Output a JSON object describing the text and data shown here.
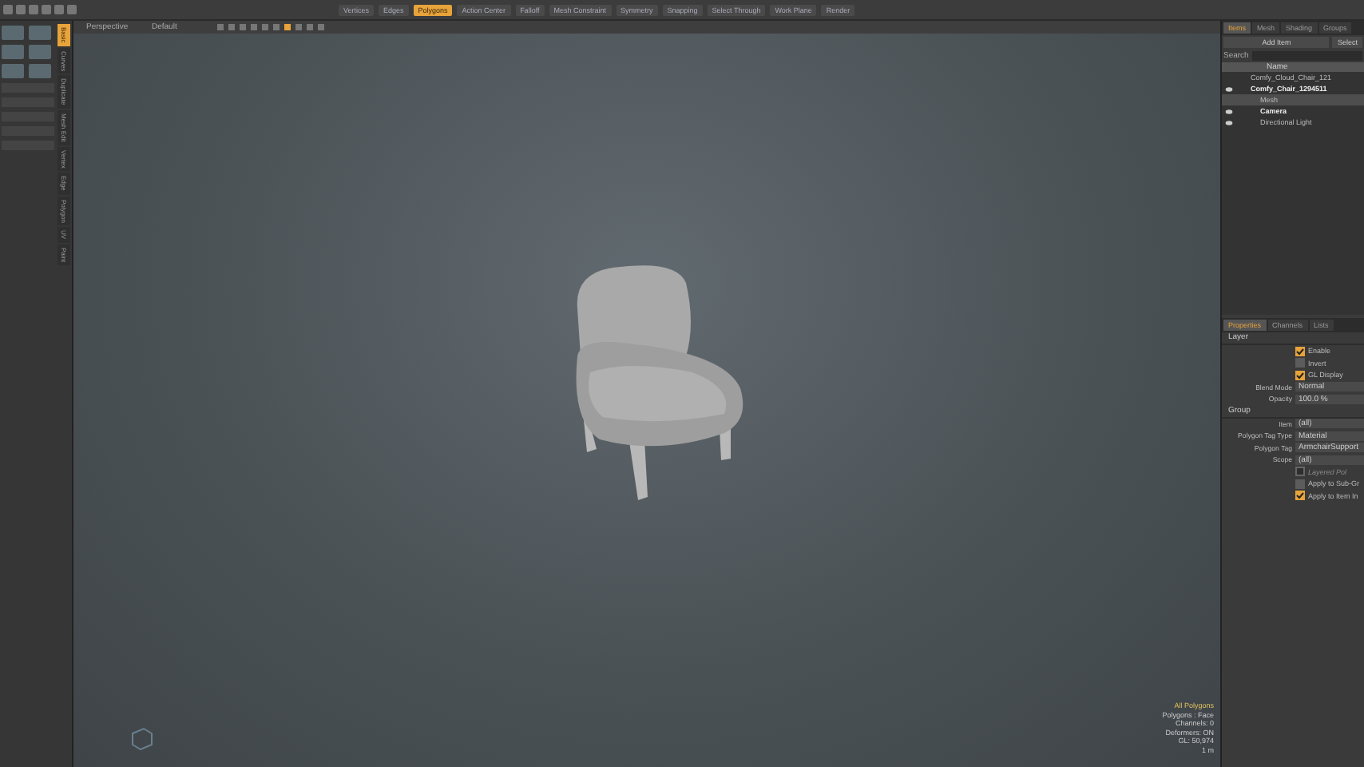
{
  "toolbar": {
    "items": [
      {
        "label": "Vertices",
        "selected": false
      },
      {
        "label": "Edges",
        "selected": false
      },
      {
        "label": "Polygons",
        "selected": true
      },
      {
        "label": "Action Center",
        "selected": false
      },
      {
        "label": "Falloff",
        "selected": false
      },
      {
        "label": "Mesh Constraint",
        "selected": false
      },
      {
        "label": "Symmetry",
        "selected": false
      },
      {
        "label": "Snapping",
        "selected": false
      },
      {
        "label": "Select Through",
        "selected": false
      },
      {
        "label": "Work Plane",
        "selected": false
      },
      {
        "label": "Render",
        "selected": false
      }
    ]
  },
  "left_panel": {
    "vertical_tabs": [
      {
        "label": "Basic",
        "selected": true
      },
      {
        "label": "Curves",
        "selected": false
      },
      {
        "label": "Duplicate",
        "selected": false
      },
      {
        "label": "Mesh Edit",
        "selected": false
      },
      {
        "label": "Vertex",
        "selected": false
      },
      {
        "label": "Edge",
        "selected": false
      },
      {
        "label": "Polygon",
        "selected": false
      },
      {
        "label": "UV",
        "selected": false
      },
      {
        "label": "Paint",
        "selected": false
      }
    ]
  },
  "viewport": {
    "view": "Perspective",
    "shading": "Default",
    "stats": [
      "All Polygons",
      "Polygons : Face",
      "Channels: 0",
      "Deformers: ON",
      "GL: 50,974",
      "1 m"
    ]
  },
  "items_panel": {
    "tabs": [
      {
        "label": "Items",
        "selected": true
      },
      {
        "label": "Mesh",
        "selected": false
      },
      {
        "label": "Shading",
        "selected": false
      },
      {
        "label": "Groups",
        "selected": false
      }
    ],
    "add_item": "Add Item",
    "select": "Select",
    "search_label": "Search",
    "name_header": "Name",
    "tree": [
      {
        "label": "Comfy_Cloud_Chair_121",
        "visible": false,
        "selected": false,
        "bold": false
      },
      {
        "label": "Comfy_Chair_1294511",
        "visible": true,
        "selected": false,
        "bold": true,
        "children": [
          {
            "label": "Mesh",
            "visible": false,
            "selected": true,
            "bold": false
          },
          {
            "label": "Camera",
            "visible": true,
            "selected": false,
            "bold": true
          },
          {
            "label": "Directional Light",
            "visible": true,
            "selected": false,
            "bold": false
          }
        ]
      }
    ]
  },
  "properties": {
    "tabs": [
      {
        "label": "Properties",
        "selected": true
      },
      {
        "label": "Channels",
        "selected": false
      },
      {
        "label": "Lists",
        "selected": false
      }
    ],
    "sections": [
      {
        "title": "Layer",
        "rows": [
          {
            "kind": "check",
            "label": "Enable",
            "checked": true,
            "disabled": false
          },
          {
            "kind": "check",
            "label": "Invert",
            "checked": false,
            "disabled": false
          },
          {
            "kind": "check",
            "label": "GL Display",
            "checked": true,
            "disabled": false
          },
          {
            "kind": "field",
            "label": "Blend Mode",
            "value": "Normal"
          },
          {
            "kind": "field",
            "label": "Opacity",
            "value": "100.0 %"
          }
        ]
      },
      {
        "title": "Group",
        "rows": [
          {
            "kind": "field",
            "label": "Item",
            "value": "(all)"
          },
          {
            "kind": "field",
            "label": "Polygon Tag Type",
            "value": "Material"
          },
          {
            "kind": "field",
            "label": "Polygon Tag",
            "value": "ArmchairSupport"
          },
          {
            "kind": "field",
            "label": "Scope",
            "value": "(all)"
          },
          {
            "kind": "check",
            "label": "Layered Pol",
            "checked": false,
            "disabled": true
          },
          {
            "kind": "check",
            "label": "Apply to Sub-Gr",
            "checked": false,
            "disabled": false
          },
          {
            "kind": "check",
            "label": "Apply to Item In",
            "checked": true,
            "disabled": false
          }
        ]
      }
    ]
  }
}
